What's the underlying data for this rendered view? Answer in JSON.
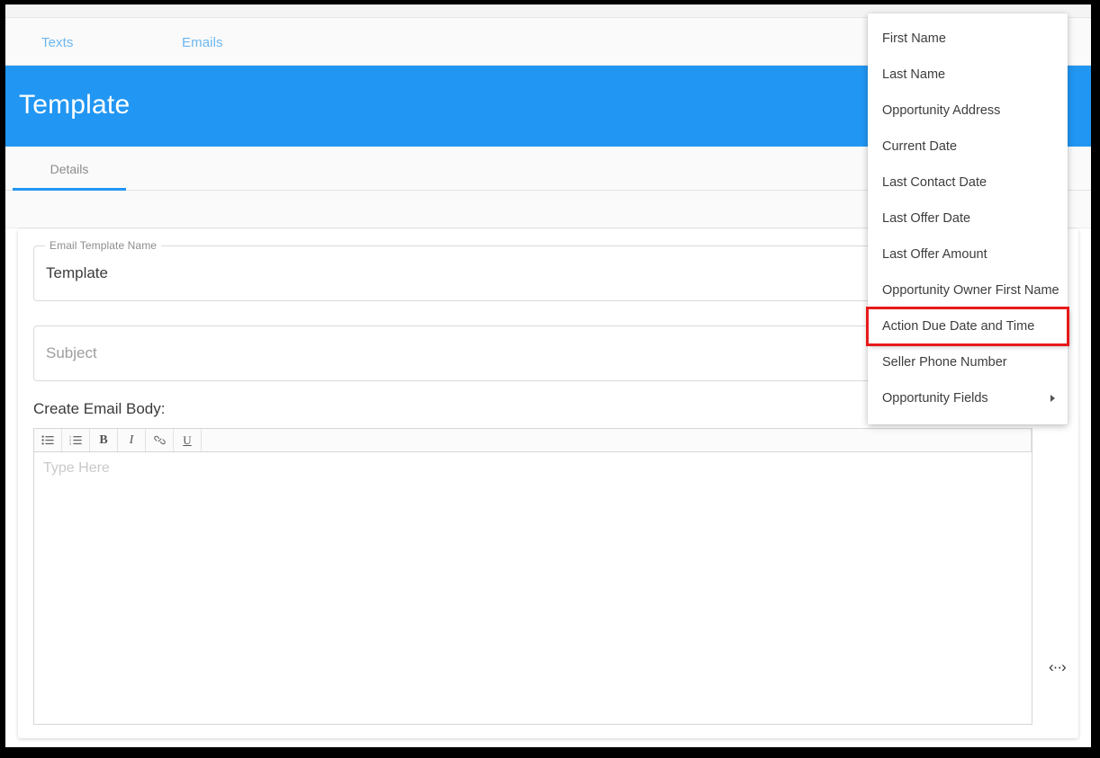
{
  "topnav": {
    "links": [
      {
        "label": "Texts"
      },
      {
        "label": "Emails"
      }
    ]
  },
  "header": {
    "title": "Template",
    "color": "#2196f3"
  },
  "tabs": [
    {
      "label": "Details",
      "active": true
    }
  ],
  "form": {
    "template_name": {
      "legend": "Email Template Name",
      "value": "Template"
    },
    "subject": {
      "legend": "",
      "placeholder": "Subject"
    }
  },
  "editor": {
    "label": "Create Email Body:",
    "placeholder": "Type Here",
    "toolbar": [
      {
        "name": "unordered-list-icon",
        "label": ""
      },
      {
        "name": "ordered-list-icon",
        "label": ""
      },
      {
        "name": "bold-icon",
        "label": "B"
      },
      {
        "name": "italic-icon",
        "label": "I"
      },
      {
        "name": "link-icon",
        "label": ""
      },
      {
        "name": "underline-icon",
        "label": "U"
      }
    ],
    "source_handle": "‹··›"
  },
  "menu": {
    "items": [
      {
        "label": "First Name",
        "submenu": false,
        "highlighted": false
      },
      {
        "label": "Last Name",
        "submenu": false,
        "highlighted": false
      },
      {
        "label": "Opportunity Address",
        "submenu": false,
        "highlighted": false
      },
      {
        "label": "Current Date",
        "submenu": false,
        "highlighted": false
      },
      {
        "label": "Last Contact Date",
        "submenu": false,
        "highlighted": false
      },
      {
        "label": "Last Offer Date",
        "submenu": false,
        "highlighted": false
      },
      {
        "label": "Last Offer Amount",
        "submenu": false,
        "highlighted": false
      },
      {
        "label": "Opportunity Owner First Name",
        "submenu": false,
        "highlighted": false
      },
      {
        "label": "Action Due Date and Time",
        "submenu": false,
        "highlighted": true
      },
      {
        "label": "Seller Phone Number",
        "submenu": false,
        "highlighted": false
      },
      {
        "label": "Opportunity Fields",
        "submenu": true,
        "highlighted": false
      }
    ],
    "highlight_color": "#e8191b"
  }
}
